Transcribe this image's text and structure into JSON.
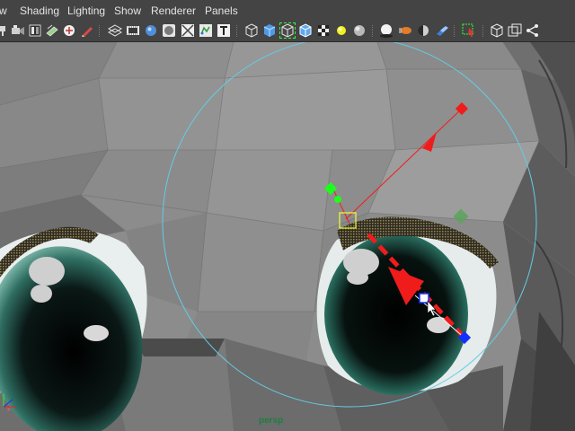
{
  "menubar": {
    "items": [
      {
        "id": "view",
        "label": "w"
      },
      {
        "id": "shading",
        "label": "Shading"
      },
      {
        "id": "lighting",
        "label": "Lighting"
      },
      {
        "id": "show",
        "label": "Show"
      },
      {
        "id": "renderer",
        "label": "Renderer"
      },
      {
        "id": "panels",
        "label": "Panels"
      }
    ]
  },
  "toolbar": {
    "icons": [
      "pin-icon",
      "camera-attributes-icon",
      "bookmark-icon",
      "image-plane-icon",
      "camera-2d-pan-icon",
      "grease-pencil-icon",
      "grid-icon",
      "film-gate-icon",
      "resolution-gate-icon",
      "gate-mask-icon",
      "field-chart-icon",
      "safe-action-icon",
      "safe-title-icon",
      "wireframe-icon",
      "smooth-shade-icon",
      "wireframe-on-shaded-icon",
      "default-material-icon",
      "textured-icon",
      "use-all-lights-icon",
      "shadows-icon",
      "screen-space-ambient-occlusion-icon",
      "motion-blur-icon",
      "multisample-aa-icon",
      "depth-of-field-icon",
      "isolate-select-icon",
      "xray-icon",
      "xray-active-components-icon",
      "xray-joints-icon"
    ]
  },
  "viewport": {
    "camera_label": "persp",
    "manipulator_ring_color": "#62cde6",
    "handle_red": "#f01c1c",
    "handle_green": "#1bff1b",
    "handle_blue": "#1130ff"
  }
}
